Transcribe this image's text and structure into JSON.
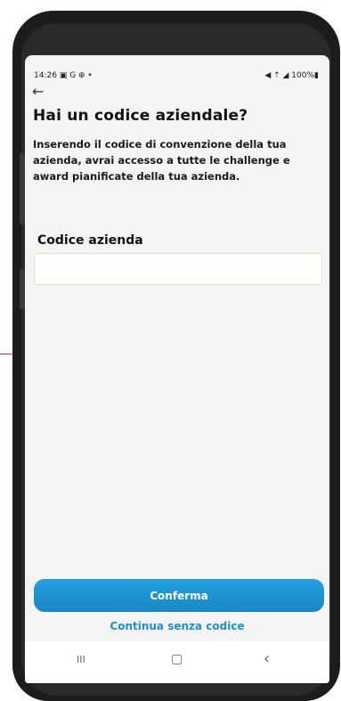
{
  "status_bar": {
    "time": "14:26",
    "left_icons": "▣ G ⊕ •",
    "right_icons": "◀ ⇡ ◢ 100%▮"
  },
  "header": {
    "back_icon": "←",
    "title": "Hai un codice aziendale?"
  },
  "description": "Inserendo il codice di convenzione della tua azienda, avrai accesso a tutte le challenge e award pianificate della tua azienda.",
  "form": {
    "field_label": "Codice azienda",
    "field_value": "",
    "field_border": "#dce7b6"
  },
  "actions": {
    "confirm_label": "Conferma",
    "skip_label": "Continua senza codice",
    "accent": "#1f8fcf"
  },
  "navbar": {
    "recent": "III",
    "home": "▢",
    "back": "‹"
  }
}
